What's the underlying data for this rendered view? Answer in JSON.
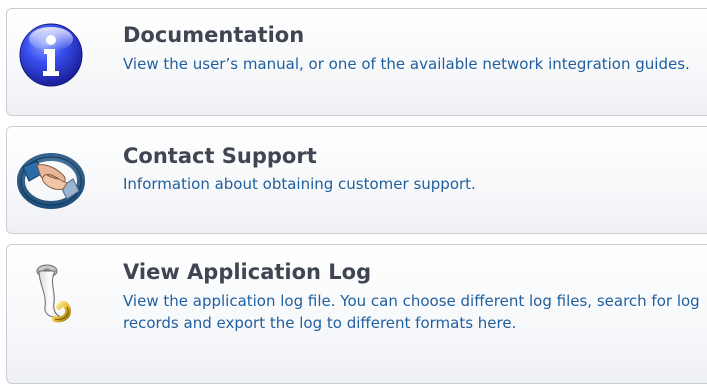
{
  "items": [
    {
      "title": "Documentation",
      "description": "View the user’s manual, or one of the available network integration guides.",
      "icon": "info-icon"
    },
    {
      "title": "Contact Support",
      "description": "Information about obtaining customer support.",
      "icon": "handshake-icon"
    },
    {
      "title": "View Application Log",
      "description": "View the application log file. You can choose different log files, search for log records and export the log to different formats here.",
      "icon": "scroll-icon"
    }
  ],
  "colors": {
    "title": "#3f4652",
    "description": "#1f5f9f",
    "panel_border": "#c9ced6",
    "info_blue": "#2a3fd6"
  }
}
